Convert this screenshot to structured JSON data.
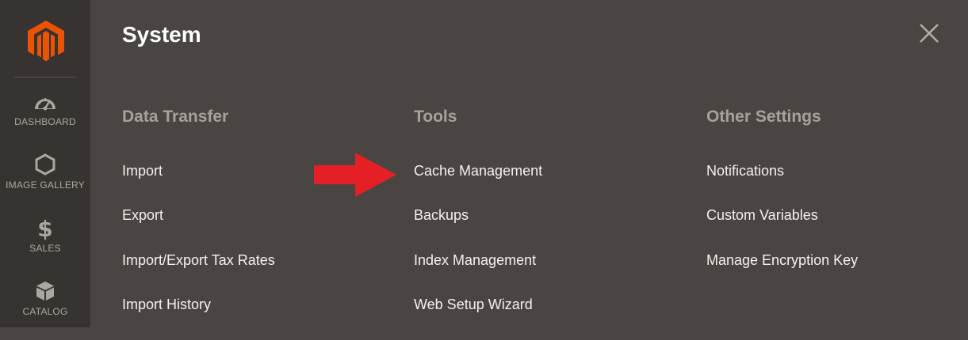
{
  "sidebar": {
    "logo_icon": "magento-logo-icon",
    "items": [
      {
        "label": "DASHBOARD",
        "icon": "dashboard-gauge-icon"
      },
      {
        "label": "IMAGE GALLERY",
        "icon": "hexagon-icon"
      },
      {
        "label": "SALES",
        "icon": "dollar-icon"
      },
      {
        "label": "CATALOG",
        "icon": "box-icon"
      }
    ]
  },
  "panel": {
    "title": "System",
    "close_icon": "close-icon"
  },
  "columns": [
    {
      "heading": "Data Transfer",
      "links": [
        "Import",
        "Export",
        "Import/Export Tax Rates",
        "Import History"
      ]
    },
    {
      "heading": "Tools",
      "links": [
        "Cache Management",
        "Backups",
        "Index Management",
        "Web Setup Wizard"
      ]
    },
    {
      "heading": "Other Settings",
      "links": [
        "Notifications",
        "Custom Variables",
        "Manage Encryption Key"
      ]
    }
  ],
  "annotation": {
    "arrow_icon": "red-arrow-icon",
    "color": "#e41f25"
  },
  "colors": {
    "sidebar_bg": "#373330",
    "panel_bg": "#4a4542",
    "logo_orange": "#eb5202",
    "heading_gray": "#a7a19c",
    "link_white": "#f3f1ee"
  }
}
